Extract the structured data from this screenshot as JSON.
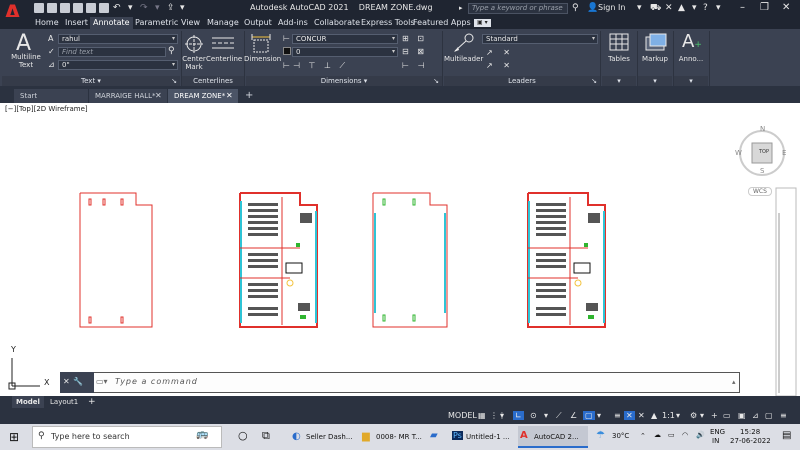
{
  "window": {
    "app_title": "Autodesk AutoCAD 2021",
    "file_name": "DREAM ZONE.dwg",
    "search_placeholder": "Type a keyword or phrase",
    "sign_in": "Sign In"
  },
  "ribbon_tabs": [
    "Home",
    "Insert",
    "Annotate",
    "Parametric",
    "View",
    "Manage",
    "Output",
    "Add-ins",
    "Collaborate",
    "Express Tools",
    "Featured Apps"
  ],
  "active_ribbon_tab": "Annotate",
  "ribbon": {
    "text_panel": {
      "multiline_text": "Multiline",
      "multiline_text2": "Text",
      "text_style": "rahul",
      "find_text_placeholder": "Find text",
      "text_angle": "0\"",
      "label": "Text"
    },
    "centerlines_panel": {
      "center_mark": "Center",
      "center_mark2": "Mark",
      "centerline": "Centerline",
      "label": "Centerlines"
    },
    "dimensions_panel": {
      "dimension": "Dimension",
      "dim_style": "CONCUR",
      "dim_layer": "0",
      "label": "Dimensions"
    },
    "leaders_panel": {
      "multileader": "Multileader",
      "leader_style": "Standard",
      "label": "Leaders"
    },
    "tables": "Tables",
    "markup": "Markup",
    "annotation": "Anno..."
  },
  "doc_tabs": [
    "Start",
    "MARRAIGE HALL*",
    "DREAM ZONE*"
  ],
  "active_doc_tab": "DREAM ZONE*",
  "viewport_label": "[−][Top][2D Wireframe]",
  "viewcube": {
    "top": "TOP",
    "north": "N",
    "south": "S",
    "east": "E",
    "west": "W",
    "wcs": "WCS"
  },
  "ucs": {
    "y": "Y",
    "x": "X"
  },
  "command_placeholder": "Type a command",
  "layout_tabs": [
    "Model",
    "Layout1"
  ],
  "active_layout_tab": "Model",
  "status": {
    "model": "MODEL",
    "scale": "1:1"
  },
  "taskbar": {
    "search_placeholder": "Type here to search",
    "apps": [
      "Seller Dash...",
      "0008- MR T...",
      "Untitled-1 ...",
      "AutoCAD 2..."
    ],
    "active_app": "AutoCAD 2...",
    "temperature": "30°C",
    "lang1": "ENG",
    "lang2": "IN",
    "time": "15:28",
    "date": "27-06-2022"
  },
  "colors": {
    "title_bg": "#1f2531",
    "ribbon_bg": "#3b4252",
    "wall_red": "#e0302b",
    "window_cyan": "#2ec4d6",
    "door_green": "#2fb52f",
    "accent_blue": "#2a6ccb"
  }
}
